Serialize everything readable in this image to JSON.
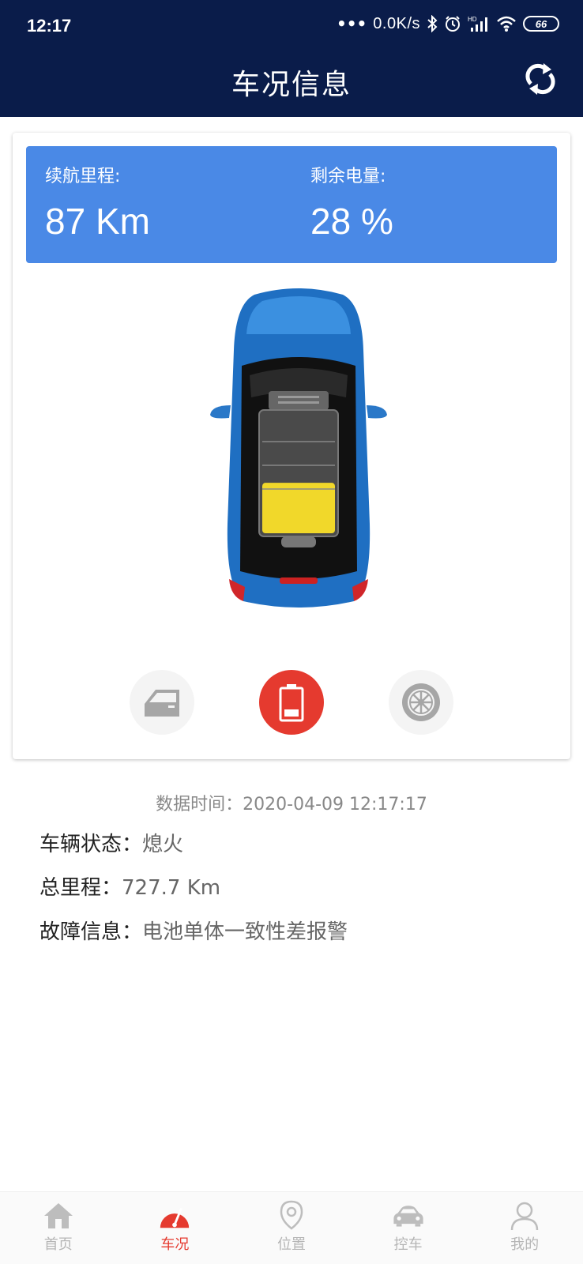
{
  "status_bar": {
    "time": "12:17",
    "network_speed": "0.0K/s",
    "battery_level": "66"
  },
  "header": {
    "title": "车况信息",
    "refresh_icon": "refresh-icon"
  },
  "summary": {
    "range_label": "续航里程:",
    "range_value": "87 Km",
    "power_label": "剩余电量:",
    "power_value": "28 %",
    "battery_fill_percent": 28,
    "box_color": "#4a89e6"
  },
  "quick_buttons": [
    {
      "icon": "door-icon",
      "active": false
    },
    {
      "icon": "battery-icon",
      "active": true
    },
    {
      "icon": "tire-icon",
      "active": false
    }
  ],
  "info": {
    "data_time_label": "数据时间：",
    "data_time_value": "2020-04-09 12:17:17",
    "status_label": "车辆状态：",
    "status_value": "熄火",
    "mileage_label": "总里程：",
    "mileage_value": "727.7 Km",
    "fault_label": "故障信息：",
    "fault_value": "电池单体一致性差报警"
  },
  "nav": {
    "items": [
      {
        "label": "首页",
        "icon": "home-icon",
        "active": false
      },
      {
        "label": "车况",
        "icon": "gauge-icon",
        "active": true
      },
      {
        "label": "位置",
        "icon": "location-icon",
        "active": false
      },
      {
        "label": "控车",
        "icon": "car-icon",
        "active": false
      },
      {
        "label": "我的",
        "icon": "user-icon",
        "active": false
      }
    ]
  },
  "colors": {
    "header_bg": "#0a1c4a",
    "accent_red": "#e53a2f",
    "inactive_gray": "#b5b5b5"
  }
}
